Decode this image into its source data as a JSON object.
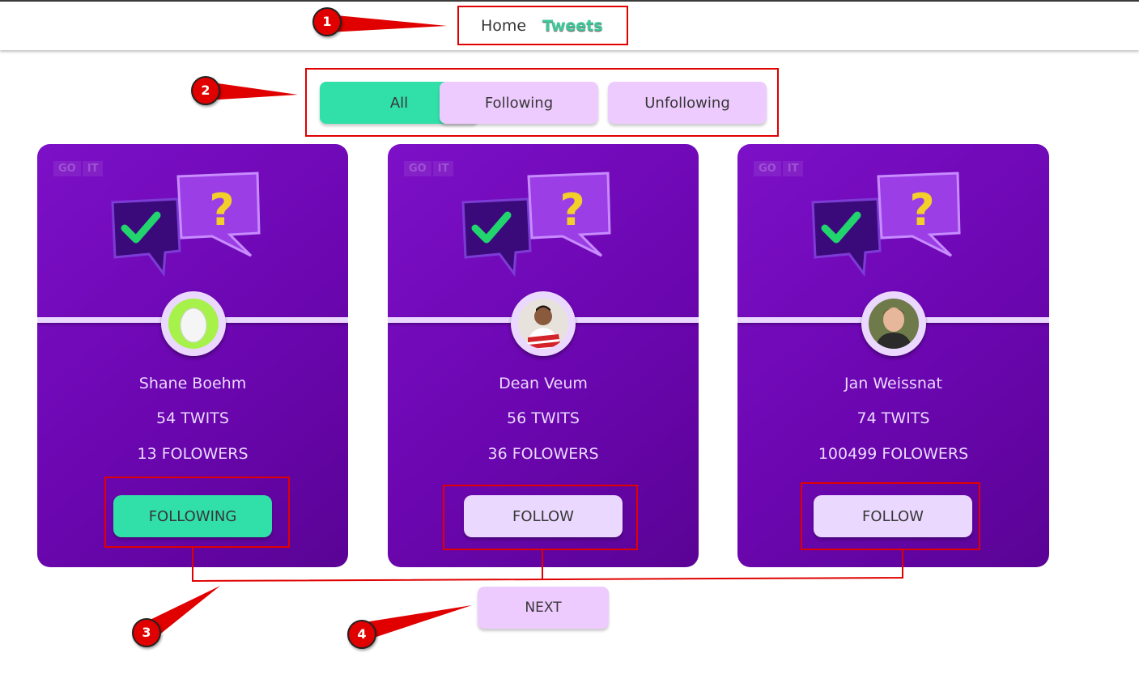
{
  "nav": {
    "home": "Home",
    "tweets": "Tweets"
  },
  "filters": [
    {
      "label": "All",
      "selected": true
    },
    {
      "label": "Following",
      "selected": false
    },
    {
      "label": "Unfollowing",
      "selected": false
    }
  ],
  "card_logo": [
    "GO",
    "IT"
  ],
  "cards": [
    {
      "name": "Shane Boehm",
      "tweets": "54 TWITS",
      "followers": "13 FOLOWERS",
      "button": "FOLLOWING",
      "following": true
    },
    {
      "name": "Dean Veum",
      "tweets": "56 TWITS",
      "followers": "36 FOLOWERS",
      "button": "FOLLOW",
      "following": false
    },
    {
      "name": "Jan Weissnat",
      "tweets": "74 TWITS",
      "followers": "100499 FOLOWERS",
      "button": "FOLLOW",
      "following": false
    }
  ],
  "next_label": "NEXT",
  "annotations": [
    "1",
    "2",
    "3",
    "4"
  ],
  "colors": {
    "accent": "#31dfa9",
    "card": "#6b06b0",
    "button": "#ebd8ff",
    "annotation": "#e00000"
  }
}
